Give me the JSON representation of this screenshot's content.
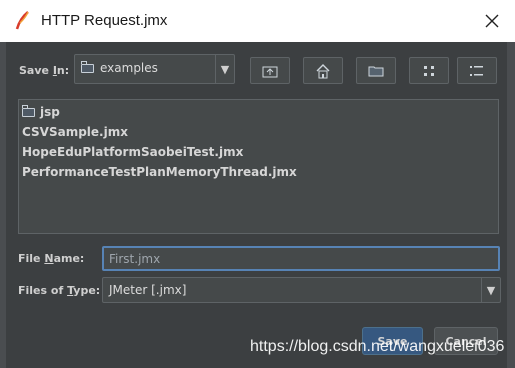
{
  "window": {
    "title": "HTTP Request.jmx"
  },
  "save_in": {
    "label_prefix": "Save ",
    "label_underlined": "I",
    "label_suffix": "n:",
    "value": "examples"
  },
  "toolbar": {
    "buttons": [
      {
        "name": "up-one-level",
        "icon": "folder-up-icon"
      },
      {
        "name": "home",
        "icon": "home-icon"
      },
      {
        "name": "new-folder",
        "icon": "new-folder-icon"
      },
      {
        "name": "list-view",
        "icon": "list-view-icon"
      },
      {
        "name": "details-view",
        "icon": "details-view-icon"
      }
    ]
  },
  "file_list": {
    "items": [
      {
        "label": "jsp",
        "type": "folder"
      },
      {
        "label": "CSVSample.jmx",
        "type": "file"
      },
      {
        "label": "HopeEduPlatformSaobeiTest.jmx",
        "type": "file"
      },
      {
        "label": "PerformanceTestPlanMemoryThread.jmx",
        "type": "file"
      }
    ]
  },
  "file_name": {
    "label_prefix": "File ",
    "label_underlined": "N",
    "label_suffix": "ame:",
    "value": "First.jmx"
  },
  "files_of_type": {
    "label_prefix": "Files of ",
    "label_underlined": "T",
    "label_suffix": "ype:",
    "value": "JMeter [.jmx]"
  },
  "buttons": {
    "save": "Save",
    "cancel": "Cancel"
  },
  "watermark": "https://blog.csdn.net/wangxuelei036",
  "colors": {
    "background": "#3c3f41",
    "field": "#45494a",
    "focus_border": "#5783b5",
    "primary_button": "#365880"
  }
}
